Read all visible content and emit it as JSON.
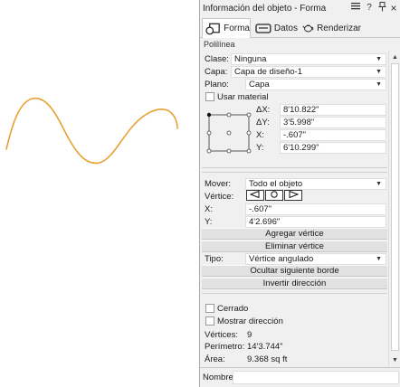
{
  "drawing": {
    "stroke_color": "#e8a035"
  },
  "window": {
    "title": "Información del objeto - Forma",
    "buttons": [
      "menu-icon",
      "help",
      "pin-icon",
      "close-icon"
    ],
    "help_label": "?",
    "close_label": "×"
  },
  "tabs": [
    {
      "label": "Forma",
      "active": true
    },
    {
      "label": "Datos",
      "active": false
    },
    {
      "label": "Renderizar",
      "active": false
    }
  ],
  "object_type": "Polilínea",
  "props": {
    "clase_label": "Clase:",
    "clase_value": "Ninguna",
    "capa_label": "Capa:",
    "capa_value": "Capa de diseño-1",
    "plano_label": "Plano:",
    "plano_value": "Capa",
    "usar_material_label": "Usar material"
  },
  "dims": {
    "dx_label": "ΔX:",
    "dx_value": "8'10.822\"",
    "dy_label": "ΔY:",
    "dy_value": "3'5.998\"",
    "x_label": "X:",
    "x_value": "-.607\"",
    "y_label": "Y:",
    "y_value": "6'10.299\""
  },
  "vertex": {
    "mover_label": "Mover:",
    "mover_value": "Todo el objeto",
    "vertice_label": "Vértice:",
    "x_label": "X:",
    "x_value": "-.607\"",
    "y_label": "Y:",
    "y_value": "4'2.696\"",
    "add_label": "Agregar vértice",
    "delete_label": "Eliminar vértice",
    "tipo_label": "Tipo:",
    "tipo_value": "Vértice angulado",
    "hide_label": "Ocultar siguiente borde",
    "reverse_label": "Invertir dirección"
  },
  "options": {
    "cerrado_label": "Cerrado",
    "mostrar_label": "Mostrar dirección"
  },
  "stats": {
    "vertices_label": "Vértices:",
    "vertices_value": "9",
    "perimetro_label": "Perímetro:",
    "perimetro_value": "14'3.744\"",
    "area_label": "Área:",
    "area_value": "9.368 sq ft"
  },
  "name_label": "Nombre:",
  "name_value": ""
}
